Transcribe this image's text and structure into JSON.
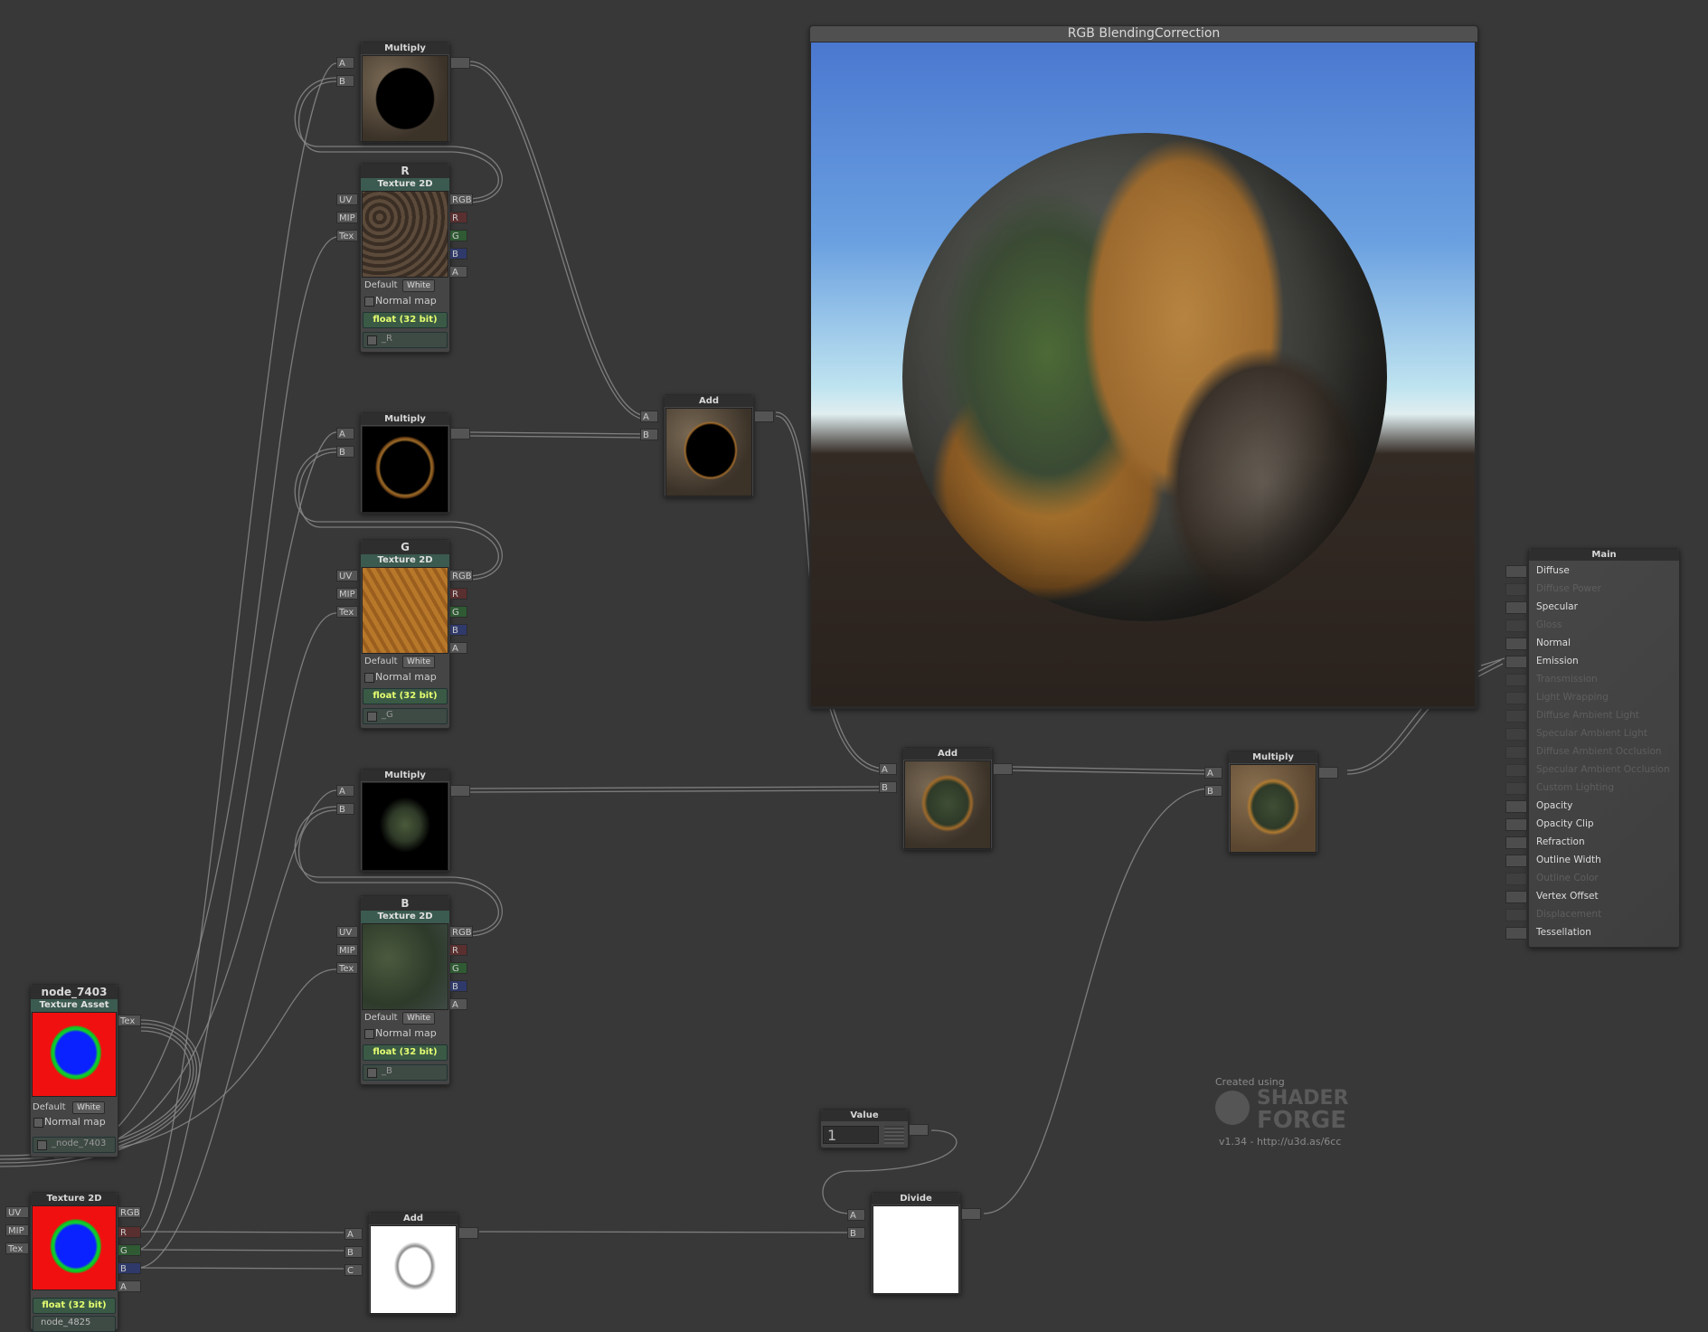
{
  "preview": {
    "title": "RGB BlendingCorrection"
  },
  "ports": {
    "a": "A",
    "b": "B",
    "c": "C",
    "uv": "UV",
    "mip": "MIP",
    "tex": "Tex",
    "rgb": "RGB",
    "r": "R",
    "g": "G",
    "b_out": "B",
    "a_out": "A"
  },
  "tex_common": {
    "default_label": "Default",
    "white_option": "White",
    "normal_map": "Normal map",
    "precision": "float (32 bit)"
  },
  "nodes": {
    "multiply_1": "Multiply",
    "multiply_2": "Multiply",
    "multiply_3": "Multiply",
    "tex_r": {
      "title": "R",
      "sub": "Texture 2D",
      "prop": "_R"
    },
    "tex_g": {
      "title": "G",
      "sub": "Texture 2D",
      "prop": "_G"
    },
    "tex_b": {
      "title": "B",
      "sub": "Texture 2D",
      "prop": "_B"
    },
    "add_1": "Add",
    "add_2": "Add",
    "add_3": "Add",
    "multiply_4": "Multiply",
    "divide": "Divide",
    "value": {
      "title": "Value",
      "val": "1"
    },
    "asset": {
      "title": "node_7403",
      "sub": "Texture Asset",
      "prop": "_node_7403"
    },
    "tex_mask": {
      "title": "Texture 2D",
      "prop": "node_4825"
    }
  },
  "main": {
    "title": "Main",
    "inputs": [
      {
        "label": "Diffuse",
        "active": true
      },
      {
        "label": "Diffuse Power",
        "active": false
      },
      {
        "label": "Specular",
        "active": true
      },
      {
        "label": "Gloss",
        "active": false
      },
      {
        "label": "Normal",
        "active": true
      },
      {
        "label": "Emission",
        "active": true
      },
      {
        "label": "Transmission",
        "active": false
      },
      {
        "label": "Light Wrapping",
        "active": false
      },
      {
        "label": "Diffuse Ambient Light",
        "active": false
      },
      {
        "label": "Specular Ambient Light",
        "active": false
      },
      {
        "label": "Diffuse Ambient Occlusion",
        "active": false
      },
      {
        "label": "Specular Ambient Occlusion",
        "active": false
      },
      {
        "label": "Custom Lighting",
        "active": false
      },
      {
        "label": "Opacity",
        "active": true
      },
      {
        "label": "Opacity Clip",
        "active": true
      },
      {
        "label": "Refraction",
        "active": true
      },
      {
        "label": "Outline Width",
        "active": true
      },
      {
        "label": "Outline Color",
        "active": false
      },
      {
        "label": "Vertex Offset",
        "active": true
      },
      {
        "label": "Displacement",
        "active": false
      },
      {
        "label": "Tessellation",
        "active": true
      }
    ]
  },
  "credits": {
    "created": "Created using",
    "logo_line1": "SHADER",
    "logo_line2": "FORGE",
    "version": "v1.34 - http://u3d.as/6cc"
  }
}
